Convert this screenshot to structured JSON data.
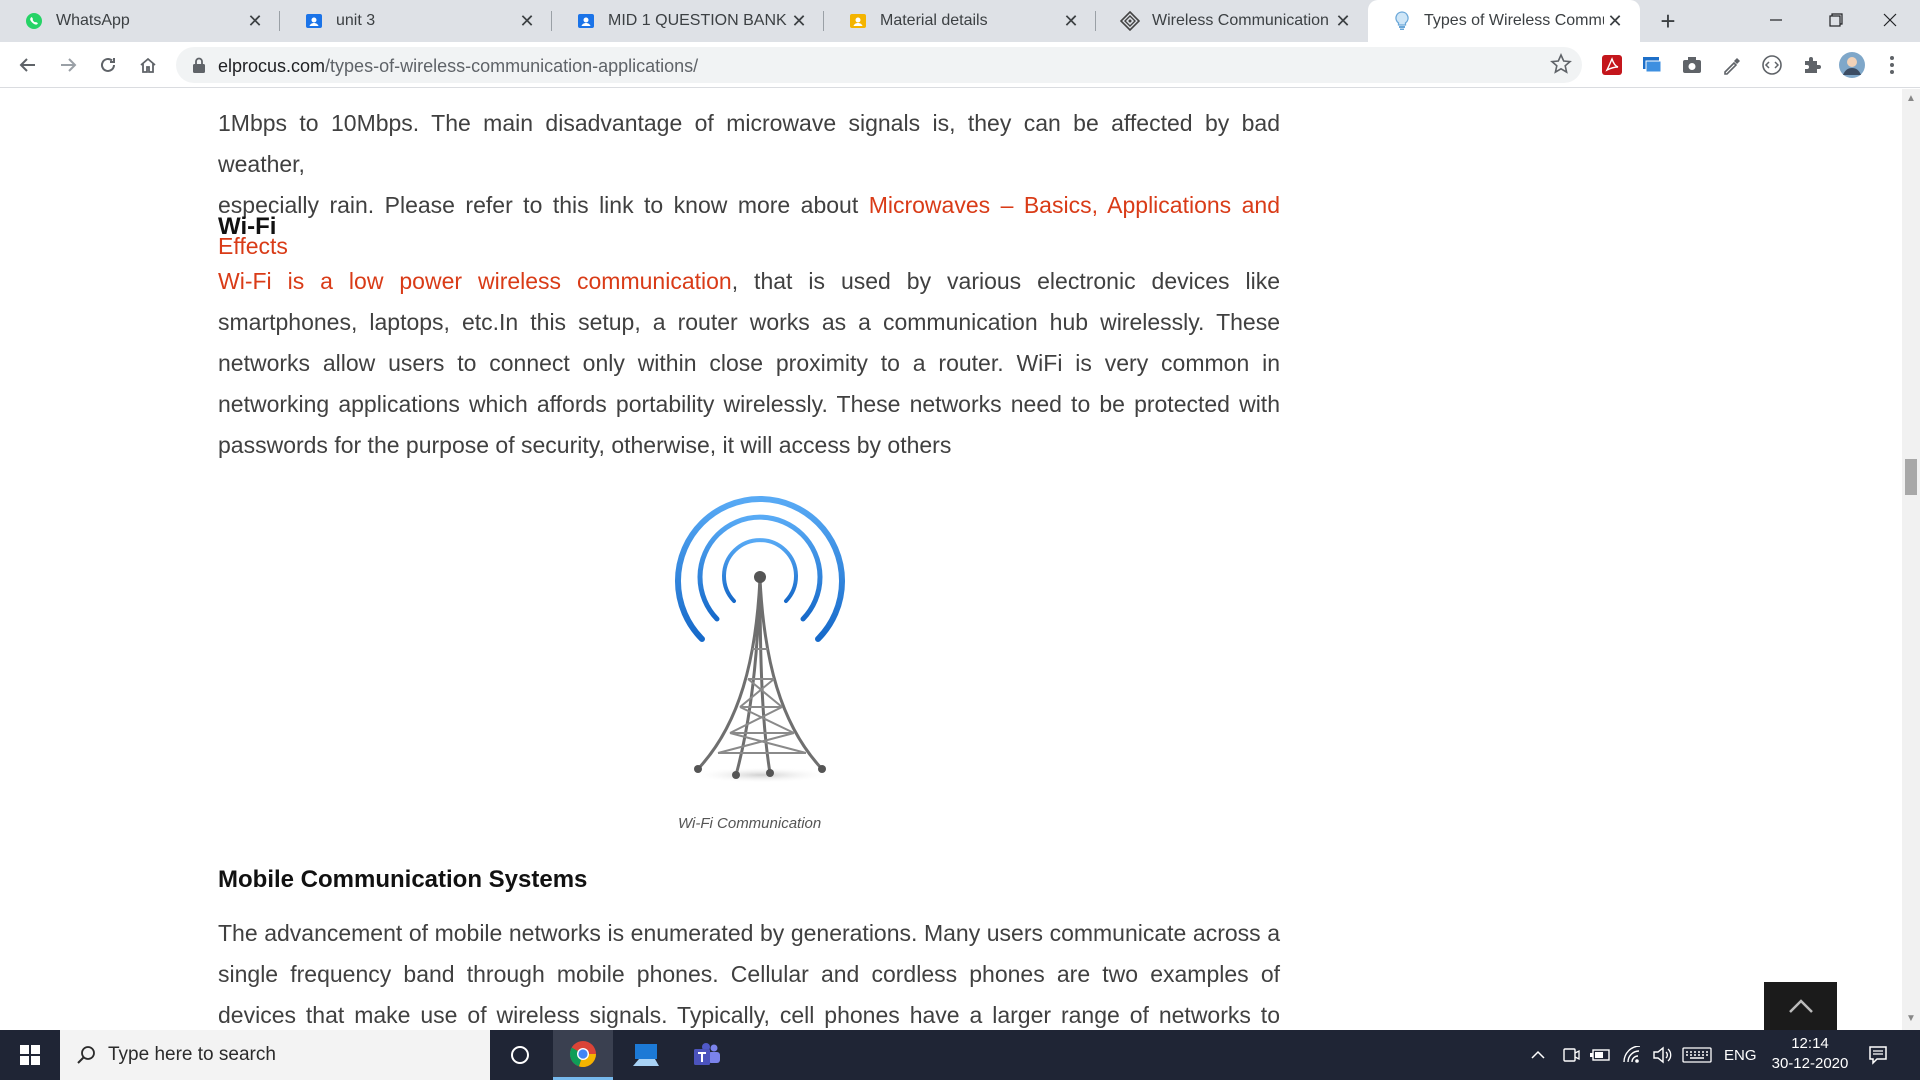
{
  "browser": {
    "tabs": [
      {
        "title": "WhatsApp",
        "active": false
      },
      {
        "title": "unit 3",
        "active": false
      },
      {
        "title": "MID 1 QUESTION BANK",
        "active": false
      },
      {
        "title": "Material details",
        "active": false
      },
      {
        "title": "Wireless Communication - O",
        "active": false
      },
      {
        "title": "Types of Wireless Communic",
        "active": true
      }
    ],
    "url_domain": "elprocus.com",
    "url_path": "/types-of-wireless-communication-applications/"
  },
  "article": {
    "intro_line1": "1Mbps to 10Mbps. The main disadvantage of microwave signals is, they can be affected by bad weather,",
    "intro_line2_pre": "especially rain. Please refer to this link to know more about ",
    "intro_link": "Microwaves – Basics, Applications and Effects",
    "wifi_heading": "Wi-Fi",
    "wifi_link": "Wi-Fi is a low power wireless communication",
    "wifi_text": ", that is used by various electronic devices like smartphones, laptops, etc.In this setup, a router works as a communication hub wirelessly. These networks allow users to connect only within close proximity to a router. WiFi is very common in networking applications which affords portability wirelessly. These networks need to be protected with passwords for the purpose of security, otherwise, it will access by others",
    "image_caption": "Wi-Fi Communication",
    "mobile_heading": "Mobile Communication Systems",
    "mobile_text": "The advancement of mobile networks is enumerated by generations. Many users communicate across a single frequency band through mobile phones. Cellular and cordless phones are two examples of devices that make use of wireless signals. Typically, cell phones have a larger range of networks to provide"
  },
  "taskbar": {
    "search_placeholder": "Type here to search",
    "language": "ENG",
    "time": "12:14",
    "date": "30-12-2020"
  },
  "colors": {
    "link": "#d93b17",
    "tab_strip": "#dee1e6",
    "taskbar": "#1f2535",
    "wifi_arc": "#2b8be6"
  }
}
